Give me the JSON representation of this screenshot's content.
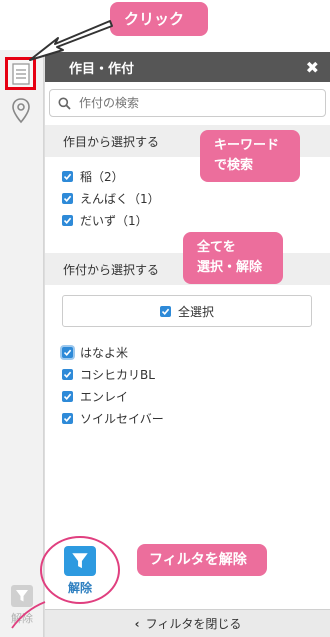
{
  "annotations": {
    "click": "クリック",
    "keyword_search": [
      "キーワード",
      "で検索"
    ],
    "select_all_toggle": [
      "全てを",
      "選択・解除"
    ],
    "clear_filter": "フィルタを解除"
  },
  "sidebar": {
    "filter_label": "解除"
  },
  "panel": {
    "title": "作目・作付",
    "close": "✖",
    "search": {
      "placeholder": "作付の検索",
      "value": ""
    },
    "crops_section": {
      "title": "作目から選択する",
      "items": [
        {
          "label": "稲（2）",
          "checked": true
        },
        {
          "label": "えんばく（1）",
          "checked": true
        },
        {
          "label": "だいず（1）",
          "checked": true
        }
      ]
    },
    "plantings_section": {
      "title": "作付から選択する",
      "select_all": "全選択",
      "items": [
        {
          "label": "はなよ米",
          "checked": true
        },
        {
          "label": "コシヒカリBL",
          "checked": true
        },
        {
          "label": "エンレイ",
          "checked": true
        },
        {
          "label": "ソイルセイバー",
          "checked": true
        }
      ]
    },
    "filter_clear_label": "解除",
    "footer": "フィルタを閉じる"
  },
  "colors": {
    "accent": "#2e8ad8",
    "callout": "#ec6e9c",
    "highlight_box": "#e60012",
    "header": "#565656"
  }
}
